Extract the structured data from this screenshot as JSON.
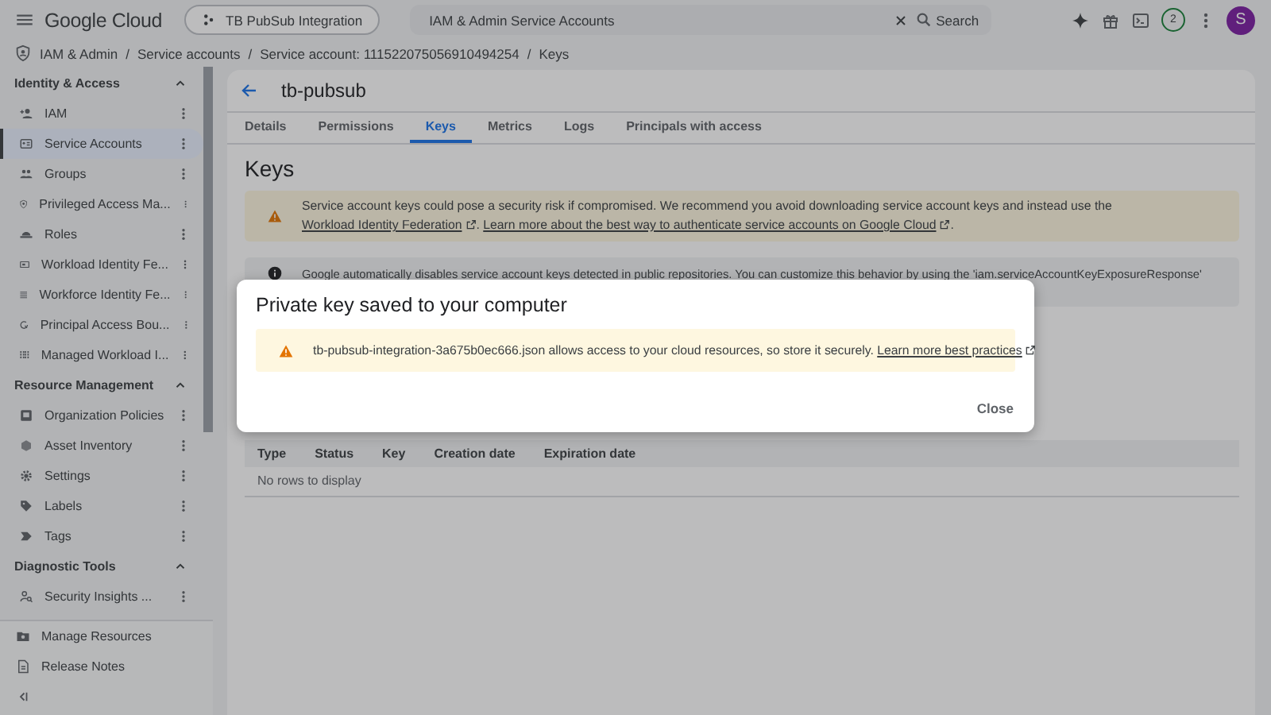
{
  "header": {
    "logo": "Google Cloud",
    "project": "TB PubSub Integration",
    "search": {
      "value": "IAM & Admin Service Accounts",
      "button": "Search"
    },
    "notifications": "2",
    "avatar": "S"
  },
  "breadcrumbs": [
    {
      "label": "IAM & Admin",
      "separator": "/"
    },
    {
      "label": "Service accounts",
      "separator": "/"
    },
    {
      "label": "Service account: 111522075056910494254",
      "separator": "/"
    },
    {
      "label": "Keys"
    }
  ],
  "sidebar": {
    "sections": [
      {
        "title": "Identity & Access",
        "expanded": true,
        "items": [
          {
            "label": "IAM",
            "selected": false
          },
          {
            "label": "Service Accounts",
            "selected": true
          },
          {
            "label": "Groups",
            "selected": false
          },
          {
            "label": "Privileged Access Ma...",
            "selected": false
          },
          {
            "label": "Roles",
            "selected": false
          },
          {
            "label": "Workload Identity Fe...",
            "selected": false
          },
          {
            "label": "Workforce Identity Fe...",
            "selected": false
          },
          {
            "label": "Principal Access Bou...",
            "selected": false
          },
          {
            "label": "Managed Workload I...",
            "selected": false
          }
        ]
      },
      {
        "title": "Resource Management",
        "expanded": true,
        "items": [
          {
            "label": "Organization Policies",
            "selected": false
          },
          {
            "label": "Asset Inventory",
            "selected": false
          },
          {
            "label": "Settings",
            "selected": false
          },
          {
            "label": "Labels",
            "selected": false
          },
          {
            "label": "Tags",
            "selected": false
          }
        ]
      },
      {
        "title": "Diagnostic Tools",
        "expanded": true,
        "items": [
          {
            "label": "Security Insights ...",
            "selected": false
          }
        ]
      }
    ],
    "footer": [
      {
        "label": "Manage Resources"
      },
      {
        "label": "Release Notes"
      }
    ]
  },
  "page": {
    "title": "tb-pubsub",
    "tabs": [
      {
        "label": "Details",
        "selected": false
      },
      {
        "label": "Permissions",
        "selected": false
      },
      {
        "label": "Keys",
        "selected": true
      },
      {
        "label": "Metrics",
        "selected": false
      },
      {
        "label": "Logs",
        "selected": false
      },
      {
        "label": "Principals with access",
        "selected": false
      }
    ],
    "heading": "Keys",
    "warning": {
      "parts": [
        {
          "kind": "text",
          "text": "Service account keys could pose a security risk if compromised. We recommend you avoid downloading service account keys and instead use the "
        },
        {
          "kind": "link",
          "text": "Workload Identity Federation"
        },
        {
          "kind": "text",
          "text": ". "
        },
        {
          "kind": "link",
          "text": "Learn more about the best way to authenticate service accounts on Google Cloud"
        },
        {
          "kind": "text",
          "text": "."
        }
      ]
    },
    "info": {
      "text": "Google automatically disables service account keys detected in public repositories. You can customize this behavior by using the 'iam.serviceAccountKeyExposureResponse'"
    },
    "table": {
      "columns": [
        "Type",
        "Status",
        "Key",
        "Creation date",
        "Expiration date"
      ],
      "empty": "No rows to display"
    }
  },
  "dialog": {
    "title": "Private key saved to your computer",
    "warning": {
      "text": "tb-pubsub-integration-3a675b0ec666.json allows access to your cloud resources, so store it securely.",
      "link": "Learn more best practices"
    },
    "button": "Close"
  }
}
